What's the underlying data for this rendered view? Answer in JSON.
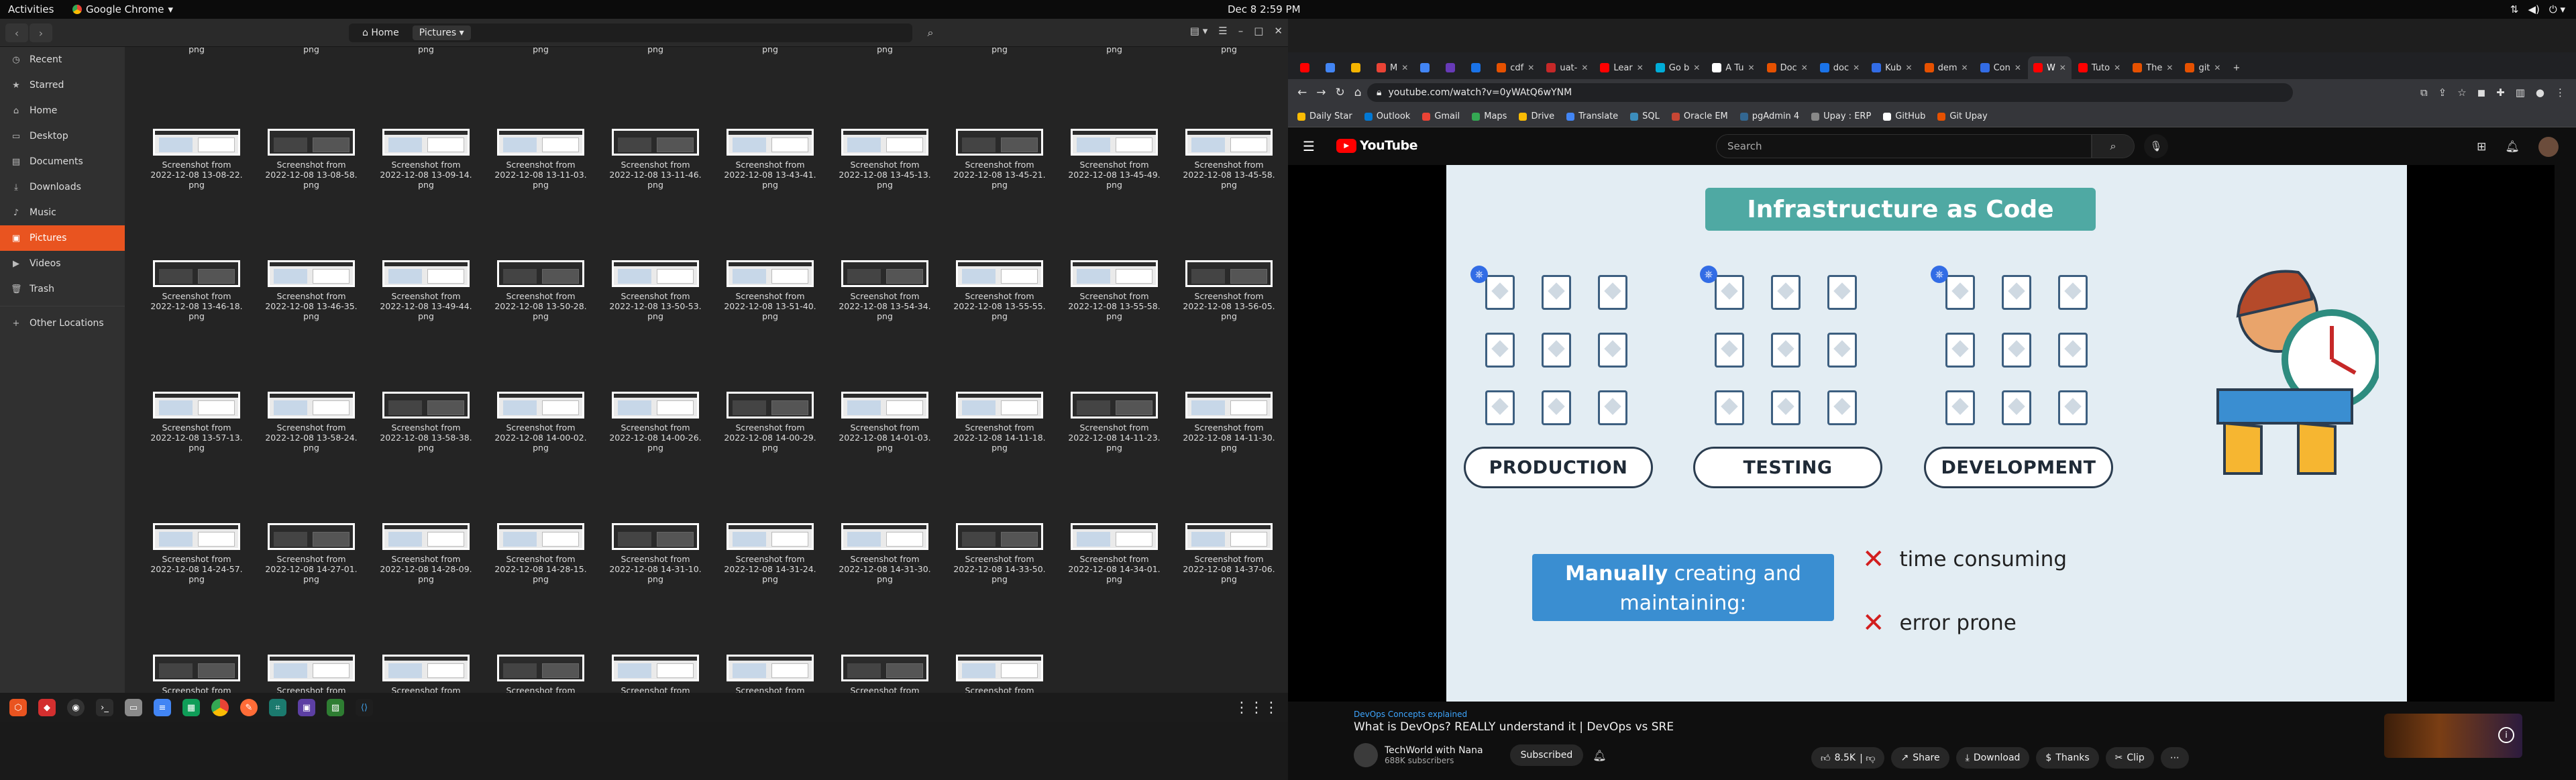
{
  "topbar": {
    "activities": "Activities",
    "app_name": "Google Chrome",
    "clock": "Dec 8  2:59 PM"
  },
  "files": {
    "path_home": "Home",
    "path_current": "Pictures",
    "sidebar": [
      {
        "label": "Recent",
        "icon": "clock-icon"
      },
      {
        "label": "Starred",
        "icon": "star-icon"
      },
      {
        "label": "Home",
        "icon": "home-icon"
      },
      {
        "label": "Desktop",
        "icon": "desktop-icon"
      },
      {
        "label": "Documents",
        "icon": "documents-icon"
      },
      {
        "label": "Downloads",
        "icon": "downloads-icon"
      },
      {
        "label": "Music",
        "icon": "music-icon"
      },
      {
        "label": "Pictures",
        "icon": "pictures-icon",
        "active": true
      },
      {
        "label": "Videos",
        "icon": "videos-icon"
      },
      {
        "label": "Trash",
        "icon": "trash-icon"
      },
      {
        "label": "Other Locations",
        "icon": "plus-icon"
      }
    ],
    "top_partial_ext": "png",
    "rows": [
      [
        {
          "l1": "Screenshot from",
          "l2": "2022-12-08 13-08-22.",
          "l3": "png"
        },
        {
          "l1": "Screenshot from",
          "l2": "2022-12-08 13-08-58.",
          "l3": "png"
        },
        {
          "l1": "Screenshot from",
          "l2": "2022-12-08 13-09-14.",
          "l3": "png"
        },
        {
          "l1": "Screenshot from",
          "l2": "2022-12-08 13-11-03.",
          "l3": "png"
        },
        {
          "l1": "Screenshot from",
          "l2": "2022-12-08 13-11-46.",
          "l3": "png"
        },
        {
          "l1": "Screenshot from",
          "l2": "2022-12-08 13-43-41.",
          "l3": "png"
        },
        {
          "l1": "Screenshot from",
          "l2": "2022-12-08 13-45-13.",
          "l3": "png"
        },
        {
          "l1": "Screenshot from",
          "l2": "2022-12-08 13-45-21.",
          "l3": "png"
        },
        {
          "l1": "Screenshot from",
          "l2": "2022-12-08 13-45-49.",
          "l3": "png"
        },
        {
          "l1": "Screenshot from",
          "l2": "2022-12-08 13-45-58.",
          "l3": "png"
        }
      ],
      [
        {
          "l1": "Screenshot from",
          "l2": "2022-12-08 13-46-18.",
          "l3": "png"
        },
        {
          "l1": "Screenshot from",
          "l2": "2022-12-08 13-46-35.",
          "l3": "png"
        },
        {
          "l1": "Screenshot from",
          "l2": "2022-12-08 13-49-44.",
          "l3": "png"
        },
        {
          "l1": "Screenshot from",
          "l2": "2022-12-08 13-50-28.",
          "l3": "png"
        },
        {
          "l1": "Screenshot from",
          "l2": "2022-12-08 13-50-53.",
          "l3": "png"
        },
        {
          "l1": "Screenshot from",
          "l2": "2022-12-08 13-51-40.",
          "l3": "png"
        },
        {
          "l1": "Screenshot from",
          "l2": "2022-12-08 13-54-34.",
          "l3": "png"
        },
        {
          "l1": "Screenshot from",
          "l2": "2022-12-08 13-55-55.",
          "l3": "png"
        },
        {
          "l1": "Screenshot from",
          "l2": "2022-12-08 13-55-58.",
          "l3": "png"
        },
        {
          "l1": "Screenshot from",
          "l2": "2022-12-08 13-56-05.",
          "l3": "png"
        }
      ],
      [
        {
          "l1": "Screenshot from",
          "l2": "2022-12-08 13-57-13.",
          "l3": "png"
        },
        {
          "l1": "Screenshot from",
          "l2": "2022-12-08 13-58-24.",
          "l3": "png"
        },
        {
          "l1": "Screenshot from",
          "l2": "2022-12-08 13-58-38.",
          "l3": "png"
        },
        {
          "l1": "Screenshot from",
          "l2": "2022-12-08 14-00-02.",
          "l3": "png"
        },
        {
          "l1": "Screenshot from",
          "l2": "2022-12-08 14-00-26.",
          "l3": "png"
        },
        {
          "l1": "Screenshot from",
          "l2": "2022-12-08 14-00-29.",
          "l3": "png"
        },
        {
          "l1": "Screenshot from",
          "l2": "2022-12-08 14-01-03.",
          "l3": "png"
        },
        {
          "l1": "Screenshot from",
          "l2": "2022-12-08 14-11-18.",
          "l3": "png"
        },
        {
          "l1": "Screenshot from",
          "l2": "2022-12-08 14-11-23.",
          "l3": "png"
        },
        {
          "l1": "Screenshot from",
          "l2": "2022-12-08 14-11-30.",
          "l3": "png"
        }
      ],
      [
        {
          "l1": "Screenshot from",
          "l2": "2022-12-08 14-24-57.",
          "l3": "png"
        },
        {
          "l1": "Screenshot from",
          "l2": "2022-12-08 14-27-01.",
          "l3": "png"
        },
        {
          "l1": "Screenshot from",
          "l2": "2022-12-08 14-28-09.",
          "l3": "png"
        },
        {
          "l1": "Screenshot from",
          "l2": "2022-12-08 14-28-15.",
          "l3": "png"
        },
        {
          "l1": "Screenshot from",
          "l2": "2022-12-08 14-31-10.",
          "l3": "png"
        },
        {
          "l1": "Screenshot from",
          "l2": "2022-12-08 14-31-24.",
          "l3": "png"
        },
        {
          "l1": "Screenshot from",
          "l2": "2022-12-08 14-31-30.",
          "l3": "png"
        },
        {
          "l1": "Screenshot from",
          "l2": "2022-12-08 14-33-50.",
          "l3": "png"
        },
        {
          "l1": "Screenshot from",
          "l2": "2022-12-08 14-34-01.",
          "l3": "png"
        },
        {
          "l1": "Screenshot from",
          "l2": "2022-12-08 14-37-06.",
          "l3": "png"
        }
      ],
      [
        {
          "l1": "Screenshot from",
          "l2": "",
          "l3": ""
        },
        {
          "l1": "Screenshot from",
          "l2": "",
          "l3": ""
        },
        {
          "l1": "Screenshot from",
          "l2": "",
          "l3": ""
        },
        {
          "l1": "Screenshot from",
          "l2": "",
          "l3": ""
        },
        {
          "l1": "Screenshot from",
          "l2": "",
          "l3": ""
        },
        {
          "l1": "Screenshot from",
          "l2": "",
          "l3": ""
        },
        {
          "l1": "Screenshot from",
          "l2": "",
          "l3": ""
        },
        {
          "l1": "Screenshot from",
          "l2": "",
          "l3": ""
        }
      ]
    ]
  },
  "chrome": {
    "tabs": [
      {
        "label": "",
        "color": "#ff0000"
      },
      {
        "label": "",
        "color": "#4285f4"
      },
      {
        "label": "",
        "color": "#f4b400"
      },
      {
        "label": "M",
        "color": "#ea4335"
      },
      {
        "label": "",
        "color": "#4285f4"
      },
      {
        "label": "",
        "color": "#673ab7"
      },
      {
        "label": "",
        "color": "#1a73e8"
      },
      {
        "label": "cdf",
        "color": "#e65100"
      },
      {
        "label": "uat-",
        "color": "#c62828"
      },
      {
        "label": "Lear",
        "color": "#ff0000"
      },
      {
        "label": "Go b",
        "color": "#00add8"
      },
      {
        "label": "A Tu",
        "color": "#ffffff"
      },
      {
        "label": "Doc",
        "color": "#e65100"
      },
      {
        "label": "doc",
        "color": "#1a73e8"
      },
      {
        "label": "Kub",
        "color": "#326ce5"
      },
      {
        "label": "dem",
        "color": "#e65100"
      },
      {
        "label": "Con",
        "color": "#326ce5"
      },
      {
        "label": "W",
        "color": "#ff0000",
        "active": true
      },
      {
        "label": "Tuto",
        "color": "#ff0000"
      },
      {
        "label": "The",
        "color": "#e65100"
      },
      {
        "label": "git",
        "color": "#e65100"
      }
    ],
    "url": "youtube.com/watch?v=0yWAtQ6wYNM",
    "bookmarks": [
      {
        "label": "Daily Star",
        "color": "#fbbc04"
      },
      {
        "label": "Outlook",
        "color": "#0078d4"
      },
      {
        "label": "Gmail",
        "color": "#ea4335"
      },
      {
        "label": "Maps",
        "color": "#34a853"
      },
      {
        "label": "Drive",
        "color": "#fbbc04"
      },
      {
        "label": "Translate",
        "color": "#4285f4"
      },
      {
        "label": "SQL",
        "color": "#3c8dbc"
      },
      {
        "label": "Oracle EM",
        "color": "#c74634"
      },
      {
        "label": "pgAdmin 4",
        "color": "#336791"
      },
      {
        "label": "Upay : ERP",
        "color": "#888888"
      },
      {
        "label": "GitHub",
        "color": "#ffffff"
      },
      {
        "label": "Git Upay",
        "color": "#e65100"
      }
    ]
  },
  "youtube": {
    "logo": "YouTube",
    "search_placeholder": "Search",
    "slide": {
      "title": "Infrastructure as Code",
      "envs": [
        "PRODUCTION",
        "TESTING",
        "DEVELOPMENT"
      ],
      "manual_bold": "Manually",
      "manual_rest": " creating and maintaining:",
      "cons": [
        "time consuming",
        "error prone"
      ]
    },
    "hashtag": "DevOps Concepts explained",
    "title": "What is DevOps? REALLY understand it | DevOps vs SRE",
    "channel": "TechWorld with Nana",
    "subs": "688K subscribers",
    "subscribed": "Subscribed",
    "likes": "8.5K",
    "share": "Share",
    "download": "Download",
    "thanks": "Thanks",
    "clip": "Clip"
  }
}
